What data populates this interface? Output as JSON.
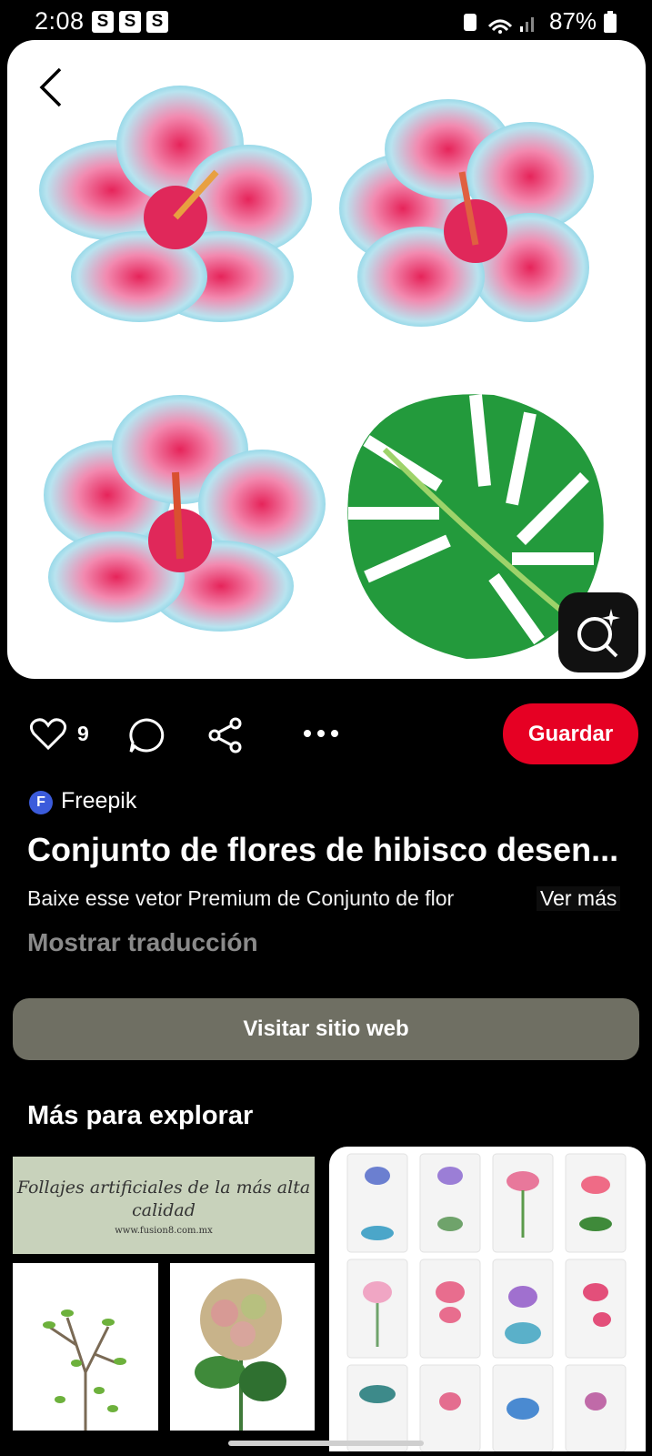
{
  "status_bar": {
    "time": "2:08",
    "notif_icons": [
      "S",
      "S",
      "S"
    ],
    "battery": "87%"
  },
  "pin": {
    "likes": "9",
    "save_label": "Guardar",
    "source_initial": "F",
    "source_name": "Freepik",
    "title": "Conjunto de flores de hibisco desen...",
    "description": "Baixe esse vetor Premium de Conjunto de flor",
    "see_more": "Ver más",
    "translate": "Mostrar traducción",
    "visit": "Visitar sitio web"
  },
  "explore": {
    "heading": "Más para explorar",
    "banner_line1": "Follajes artificiales de la más alta calidad",
    "banner_line2": "www.fusion8.com.mx"
  },
  "colors": {
    "save": "#e60023",
    "visit": "#6f6f63",
    "source": "#3b5bdb"
  }
}
